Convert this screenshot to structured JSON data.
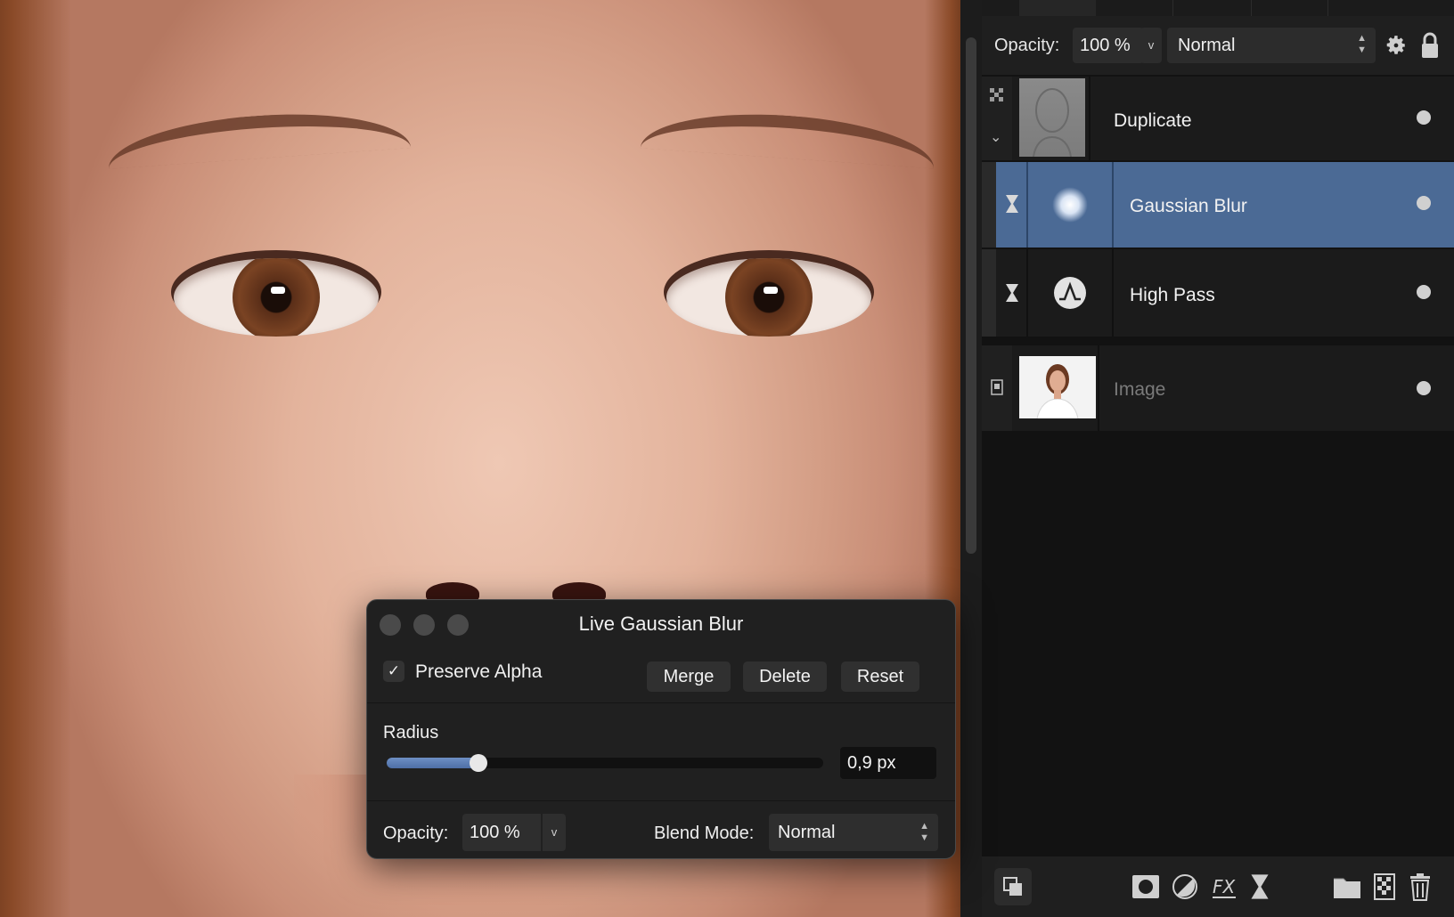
{
  "layers_panel": {
    "opacity_label": "Opacity:",
    "opacity_value": "100 %",
    "blend_mode": "Normal",
    "layers": [
      {
        "name": "Duplicate",
        "selected": false,
        "dimmed": false
      },
      {
        "name": "Gaussian Blur",
        "selected": true,
        "dimmed": false
      },
      {
        "name": "High Pass",
        "selected": false,
        "dimmed": false
      },
      {
        "name": "Image",
        "selected": false,
        "dimmed": true
      }
    ]
  },
  "dialog": {
    "title": "Live Gaussian Blur",
    "preserve_alpha_label": "Preserve Alpha",
    "preserve_alpha_checked": true,
    "merge_label": "Merge",
    "delete_label": "Delete",
    "reset_label": "Reset",
    "radius_label": "Radius",
    "radius_value": "0,9 px",
    "radius_slider_fraction": 0.21,
    "opacity_label": "Opacity:",
    "opacity_value": "100 %",
    "blend_mode_label": "Blend Mode:",
    "blend_mode_value": "Normal"
  },
  "colors": {
    "selection": "#4b6a95",
    "panel_bg": "#121212",
    "slider_fill": "#5a7cb5"
  },
  "icons": {
    "checkmark": "✓",
    "dropdown": "v",
    "stepper": "⌃⌄"
  }
}
